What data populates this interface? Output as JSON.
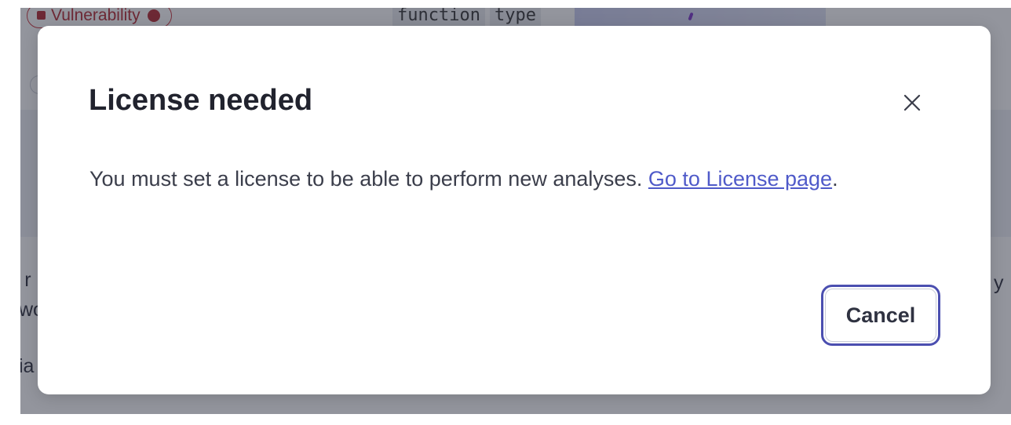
{
  "background": {
    "vulnerability_tag": "Vulnerability",
    "code_tokens": [
      "function",
      "type"
    ],
    "fragment_left_1": "› r",
    "fragment_left_2": "wo",
    "fragment_left_3": "ia",
    "fragment_right_1": "y"
  },
  "modal": {
    "title": "License needed",
    "close_icon": "close-icon",
    "body_text": "You must set a license to be able to perform new analyses. ",
    "link_text": "Go to License page",
    "body_suffix": ".",
    "cancel_label": "Cancel"
  },
  "colors": {
    "accent": "#4b4fb0",
    "link": "#4f5ac9",
    "danger": "#b3262e"
  }
}
